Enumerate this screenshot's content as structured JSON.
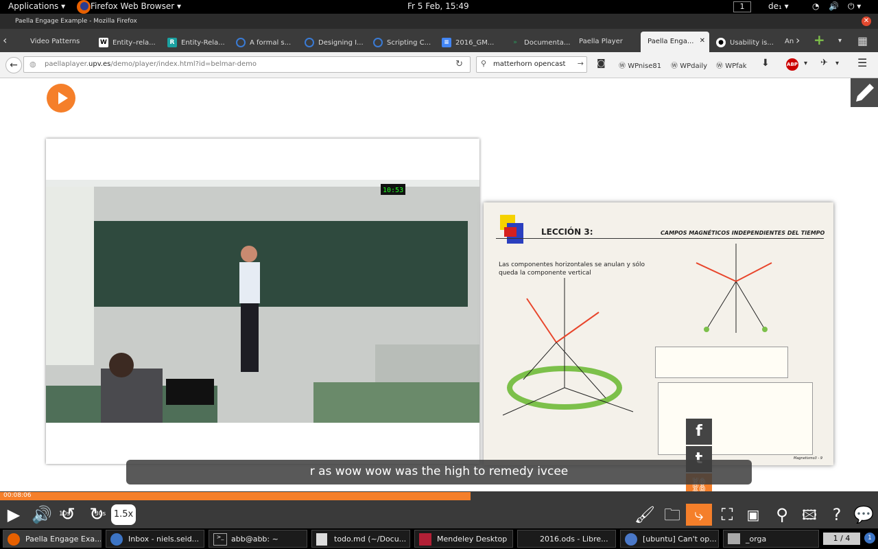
{
  "topbar": {
    "applications": "Applications",
    "app_name": "Firefox Web Browser",
    "clock": "Fr  5 Feb, 15:49",
    "workspace": "1",
    "keyboard": "de₁"
  },
  "window": {
    "title": "Paella Engage Example - Mozilla Firefox"
  },
  "tabs": [
    {
      "label": "Video Patterns"
    },
    {
      "label": "Entity–rela..."
    },
    {
      "label": "Entity-Rela..."
    },
    {
      "label": "A formal s..."
    },
    {
      "label": "Designing I..."
    },
    {
      "label": "Scripting C..."
    },
    {
      "label": "2016_GM..."
    },
    {
      "label": "Documenta..."
    },
    {
      "label": "Paella Player"
    },
    {
      "label": "Paella Enga..."
    },
    {
      "label": "Usability is..."
    },
    {
      "label": "An"
    }
  ],
  "navbar": {
    "url_prefix": "paellaplayer.",
    "url_domain": "upv.es",
    "url_path": "/demo/player/index.html?id=belmar-demo",
    "search_value": "matterhorn opencast",
    "bookmarks": [
      "WPnise81",
      "WPdaily",
      "WPfak"
    ],
    "abp": "ABP"
  },
  "slide": {
    "lesson": "LECCIÓN 3:",
    "heading": "CAMPOS MAGNÉTICOS INDEPENDIENTES DEL TIEMPO",
    "text": "Las componentes horizontales se anulan y sólo queda la componente vertical",
    "footer": "Magnetismo3 - 9"
  },
  "video": {
    "clock": "10:53"
  },
  "player": {
    "subtitle": "r as wow wow was the high to remedy ivcee",
    "time": "00:08:06",
    "progress": 0.536,
    "speed": "1.5x",
    "rewind": "10s",
    "forward": "30s"
  },
  "taskbar": [
    {
      "label": "Paella Engage Exa..."
    },
    {
      "label": "Inbox - niels.seid..."
    },
    {
      "label": "abb@abb: ~"
    },
    {
      "label": "todo.md (~/Docu..."
    },
    {
      "label": "Mendeley Desktop"
    },
    {
      "label": "2016.ods - Libre..."
    },
    {
      "label": "[ubuntu] Can't op..."
    },
    {
      "label": "_orga"
    }
  ],
  "pager": "1 / 4",
  "colors": {
    "accent": "#f57f2a",
    "controls": "#3a3a3a"
  }
}
